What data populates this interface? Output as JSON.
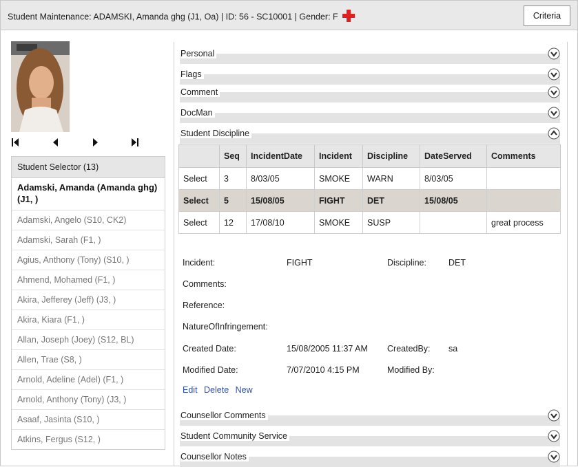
{
  "header": {
    "title": "Student Maintenance: ADAMSKI, Amanda ghg (J1, Oa) | ID: 56 - SC10001 | Gender: F",
    "criteria_label": "Criteria"
  },
  "selector": {
    "header": "Student Selector (13)",
    "selected": "Adamski, Amanda (Amanda ghg) (J1, )",
    "items": [
      "Adamski, Angelo (S10, CK2)",
      "Adamski, Sarah (F1, )",
      "Agius, Anthony (Tony) (S10, )",
      "Ahmend, Mohamed (F1, )",
      "Akira, Jefferey (Jeff) (J3, )",
      "Akira, Kiara (F1, )",
      "Allan, Joseph (Joey) (S12, BL)",
      "Allen, Trae (S8, )",
      "Arnold, Adeline (Adel) (F1, )",
      "Arnold, Anthony (Tony) (J3, )",
      "Asaaf, Jasinta (S10, )",
      "Atkins, Fergus (S12, )"
    ]
  },
  "sections": {
    "personal": "Personal",
    "flags": "Flags",
    "comment": "Comment",
    "docman": "DocMan",
    "discipline": "Student Discipline",
    "counsellor_comments": "Counsellor Comments",
    "community_service": "Student Community Service",
    "counsellor_notes": "Counsellor Notes"
  },
  "discipline_table": {
    "columns": [
      "",
      "Seq",
      "IncidentDate",
      "Incident",
      "Discipline",
      "DateServed",
      "Comments"
    ],
    "rows": [
      [
        "Select",
        "3",
        "8/03/05",
        "SMOKE",
        "WARN",
        "8/03/05",
        ""
      ],
      [
        "Select",
        "5",
        "15/08/05",
        "FIGHT",
        "DET",
        "15/08/05",
        ""
      ],
      [
        "Select",
        "12",
        "17/08/10",
        "SMOKE",
        "SUSP",
        "",
        "great process"
      ]
    ]
  },
  "detail": {
    "incident_label": "Incident:",
    "incident_value": "FIGHT",
    "discipline_label": "Discipline:",
    "discipline_value": "DET",
    "comments_label": "Comments:",
    "reference_label": "Reference:",
    "nature_label": "NatureOfInfringement:",
    "created_date_label": "Created Date:",
    "created_date_value": "15/08/2005 11:37 AM",
    "created_by_label": "CreatedBy:",
    "created_by_value": "sa",
    "modified_date_label": "Modified Date:",
    "modified_date_value": "7/07/2010 4:15 PM",
    "modified_by_label": "Modified By:",
    "edit": "Edit",
    "delete": "Delete",
    "new": "New"
  },
  "colors": {
    "accent_cross": "#e02020",
    "link": "#2f4fa8",
    "selected_row": "#dad6cf"
  }
}
